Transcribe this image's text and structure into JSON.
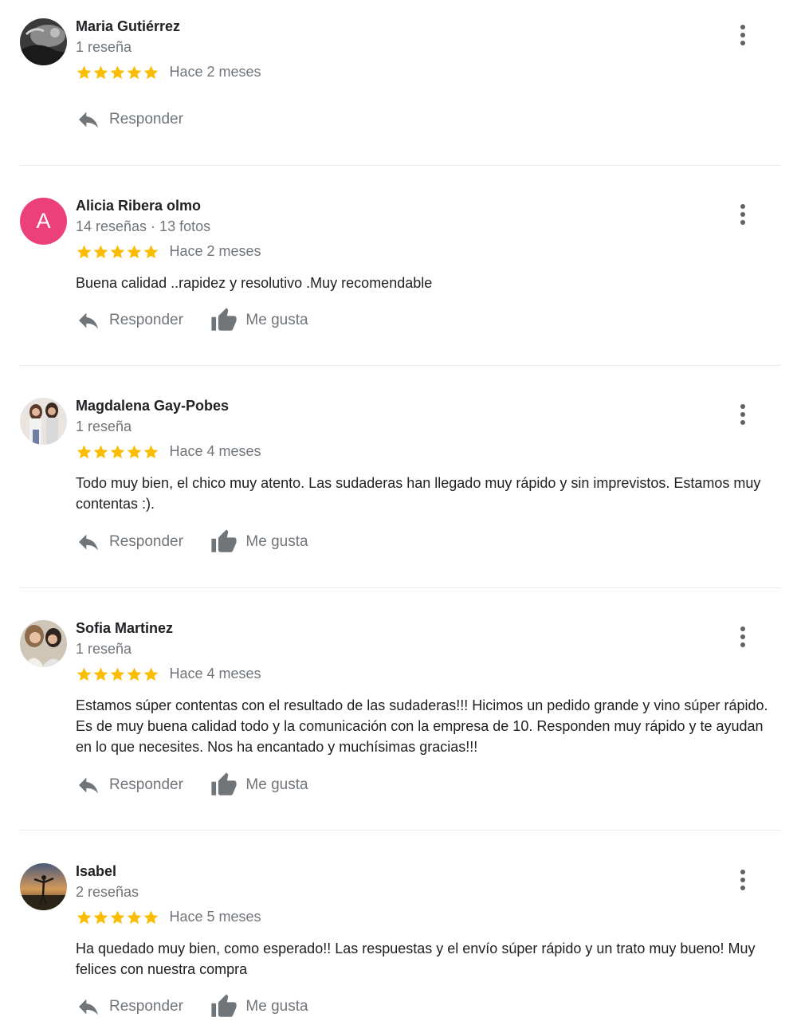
{
  "colors": {
    "star": "#fbbc04",
    "secondary_text": "#70757a",
    "primary_text": "#202124",
    "avatar_letter_bg": "#ec407a",
    "divider": "#e8eaed"
  },
  "icons": {
    "reply": "reply-arrow-icon",
    "like": "thumbs-up-icon",
    "menu": "more-vert-icon",
    "star": "star-icon"
  },
  "labels": {
    "reply": "Responder",
    "like": "Me gusta"
  },
  "reviews": [
    {
      "name": "Maria Gutiérrez",
      "meta": "1 reseña",
      "stars": 5,
      "date": "Hace 2 meses",
      "text": "",
      "avatar": "photo"
    },
    {
      "name": "Alicia Ribera olmo",
      "meta": "14 reseñas · 13 fotos",
      "stars": 5,
      "date": "Hace 2 meses",
      "text": "Buena calidad ..rapidez y resolutivo .Muy recomendable",
      "avatar_letter": "A"
    },
    {
      "name": "Magdalena Gay-Pobes",
      "meta": "1 reseña",
      "stars": 5,
      "date": "Hace 4 meses",
      "text": "Todo muy bien, el chico muy atento. Las sudaderas han llegado muy rápido y sin imprevistos. Estamos muy contentas :).",
      "avatar": "photo"
    },
    {
      "name": "Sofia Martinez",
      "meta": "1 reseña",
      "stars": 5,
      "date": "Hace 4 meses",
      "text": "Estamos súper contentas con el resultado de las sudaderas!!! Hicimos un pedido grande y vino súper rápido. Es de muy buena calidad todo y la comunicación con la empresa de 10. Responden muy rápido y te ayudan en lo que necesites. Nos ha encantado y muchísimas gracias!!!",
      "avatar": "photo"
    },
    {
      "name": "Isabel",
      "meta": "2 reseñas",
      "stars": 5,
      "date": "Hace 5 meses",
      "text": "Ha quedado muy bien, como esperado!! Las respuestas y el envío súper rápido y un trato muy bueno! Muy felices con nuestra compra",
      "avatar": "photo"
    }
  ]
}
